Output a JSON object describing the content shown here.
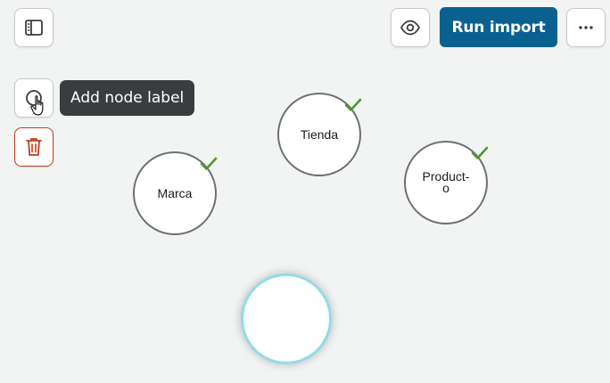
{
  "toolbar": {
    "sidebar_toggle_icon": "sidebar-panel-icon",
    "preview_icon": "eye-icon",
    "run_import_label": "Run import",
    "more_icon": "ellipsis-icon",
    "accent_color": "#0a6190"
  },
  "side_tools": {
    "add_node_icon": "circle-icon",
    "add_node_tooltip": "Add node label",
    "delete_icon": "trash-icon",
    "delete_color": "#c13b1b"
  },
  "graph": {
    "nodes": [
      {
        "label": "Tienda",
        "status": "complete",
        "status_icon": "checkmark-icon"
      },
      {
        "label": "Marca",
        "status": "complete",
        "status_icon": "checkmark-icon"
      },
      {
        "label": "Product-o",
        "status": "complete",
        "status_icon": "checkmark-icon"
      }
    ],
    "new_node": {
      "label": "",
      "highlight_color": "#8fdde6"
    },
    "check_color": "#4c9a2a"
  }
}
